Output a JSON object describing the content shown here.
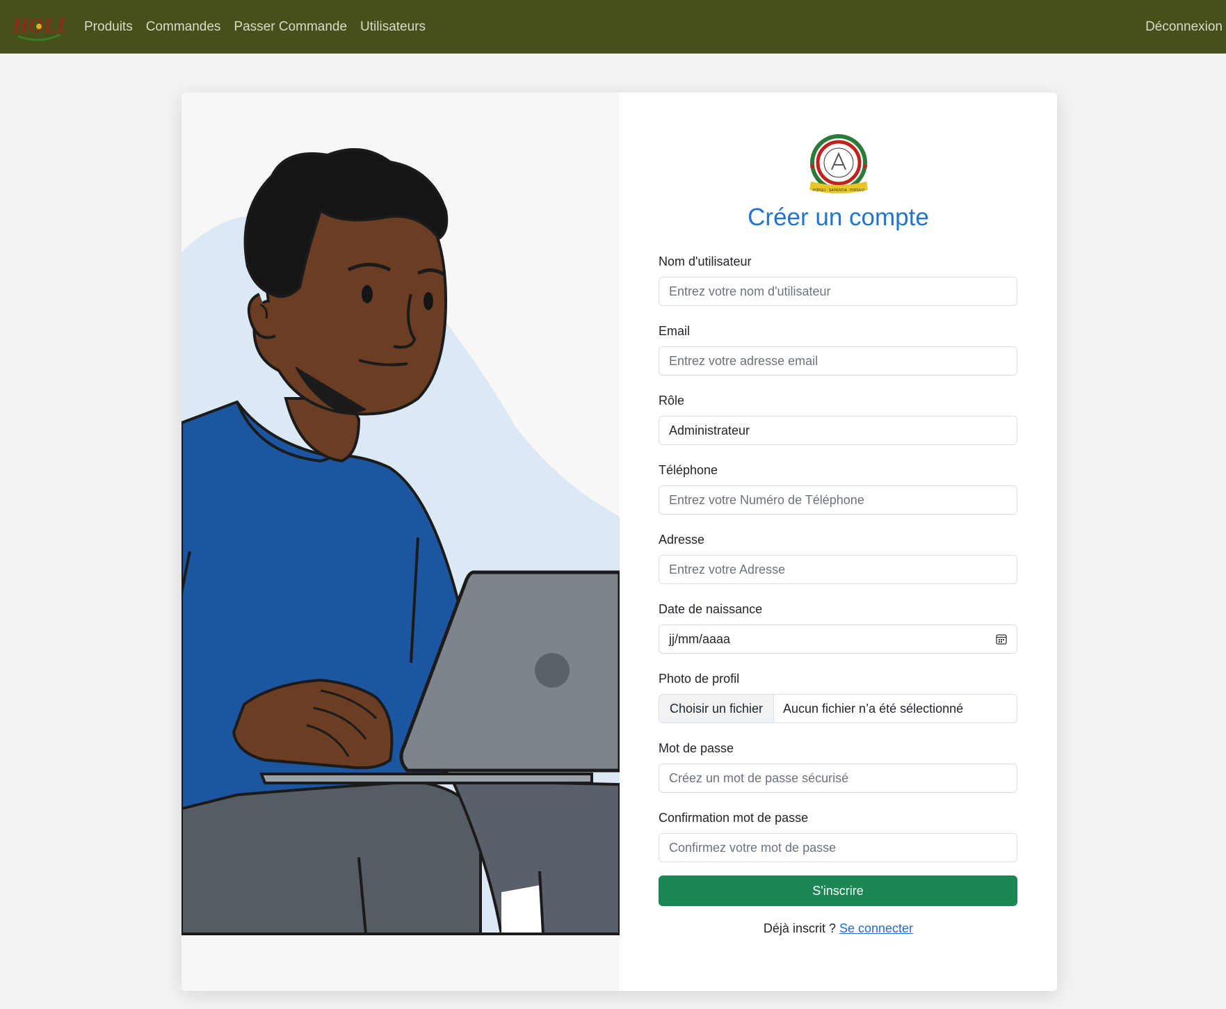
{
  "navbar": {
    "logo_text": "HOLD",
    "links": [
      "Produits",
      "Commandes",
      "Passer Commande",
      "Utilisateurs"
    ],
    "logout": "Déconnexion"
  },
  "form": {
    "title": "Créer un compte",
    "fields": {
      "username": {
        "label": "Nom d'utilisateur",
        "placeholder": "Entrez votre nom d'utilisateur"
      },
      "email": {
        "label": "Email",
        "placeholder": "Entrez votre adresse email"
      },
      "role": {
        "label": "Rôle",
        "value": "Administrateur"
      },
      "phone": {
        "label": "Téléphone",
        "placeholder": "Entrez votre Numéro de Téléphone"
      },
      "address": {
        "label": "Adresse",
        "placeholder": "Entrez votre Adresse"
      },
      "birthdate": {
        "label": "Date de naissance",
        "placeholder": "jj/mm/aaaa"
      },
      "photo": {
        "label": "Photo de profil",
        "button": "Choisir un fichier",
        "status": "Aucun fichier n’a été sélectionné"
      },
      "password": {
        "label": "Mot de passe",
        "placeholder": "Créez un mot de passe sécurisé"
      },
      "confirm": {
        "label": "Confirmation mot de passe",
        "placeholder": "Confirmez votre mot de passe"
      }
    },
    "submit": "S'inscrire",
    "already": "Déjà inscrit ?",
    "login_link": "Se connecter"
  },
  "emblem": {
    "motto": "POPULI · SAPIENTIA · POPULO"
  },
  "colors": {
    "navbar": "#484f1a",
    "title": "#1f74d4",
    "submit": "#1b8754",
    "link": "#1f6fd1"
  }
}
